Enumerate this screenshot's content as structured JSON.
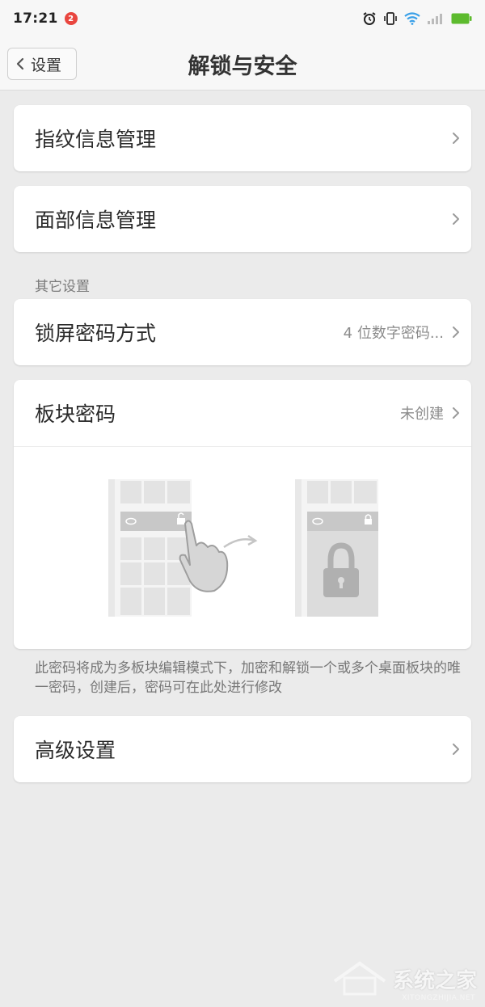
{
  "status_bar": {
    "time": "17:21",
    "notification_count": "2",
    "icons": [
      "alarm-icon",
      "vibrate-icon",
      "wifi-icon",
      "signal-icon",
      "battery-icon"
    ],
    "battery_color": "#5dbb2e"
  },
  "header": {
    "back_label": "设置",
    "title": "解锁与安全"
  },
  "menu": {
    "fingerprint": {
      "label": "指纹信息管理"
    },
    "face": {
      "label": "面部信息管理"
    },
    "other_section": "其它设置",
    "lockscreen_password": {
      "label": "锁屏密码方式",
      "value": "4 位数字密码..."
    },
    "block_password": {
      "label": "板块密码",
      "value": "未创建"
    },
    "block_password_note": "此密码将成为多板块编辑模式下，加密和解锁一个或多个桌面板块的唯一密码，创建后，密码可在此处进行修改",
    "advanced": {
      "label": "高级设置"
    }
  },
  "watermark": {
    "title": "系统之家",
    "subtitle": "XITONGZHIJIA.NET"
  }
}
